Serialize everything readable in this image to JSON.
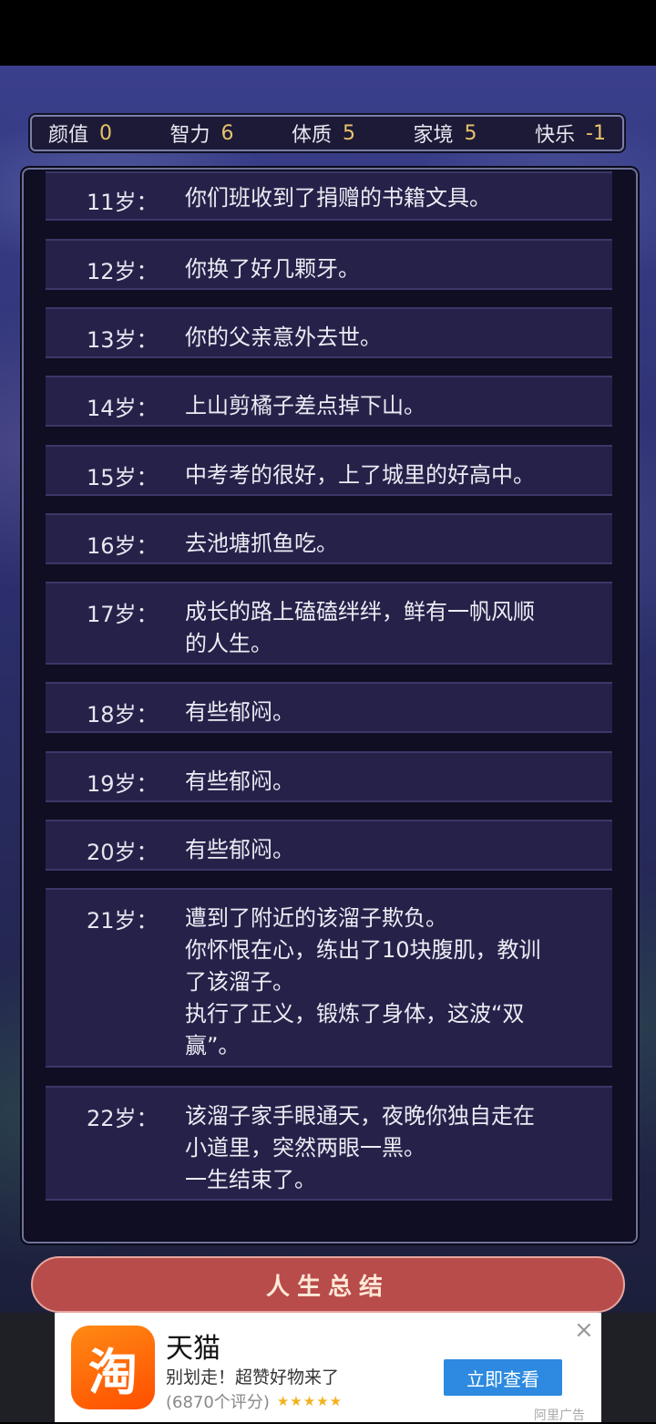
{
  "stats": [
    {
      "label": "颜值",
      "value": "0"
    },
    {
      "label": "智力",
      "value": "6"
    },
    {
      "label": "体质",
      "value": "5"
    },
    {
      "label": "家境",
      "value": "5"
    },
    {
      "label": "快乐",
      "value": "-1"
    }
  ],
  "events": [
    {
      "age": "11岁：",
      "text": "你们班收到了捐赠的书籍文具。"
    },
    {
      "age": "12岁：",
      "text": "你换了好几颗牙。"
    },
    {
      "age": "13岁：",
      "text": "你的父亲意外去世。"
    },
    {
      "age": "14岁：",
      "text": "上山剪橘子差点掉下山。"
    },
    {
      "age": "15岁：",
      "text": "中考考的很好，上了城里的好高中。"
    },
    {
      "age": "16岁：",
      "text": "去池塘抓鱼吃。"
    },
    {
      "age": "17岁：",
      "text": "成长的路上磕磕绊绊，鲜有一帆风顺\n的人生。"
    },
    {
      "age": "18岁：",
      "text": "有些郁闷。"
    },
    {
      "age": "19岁：",
      "text": "有些郁闷。"
    },
    {
      "age": "20岁：",
      "text": "有些郁闷。"
    },
    {
      "age": "21岁：",
      "text": "遭到了附近的该溜子欺负。\n你怀恨在心，练出了10块腹肌，教训\n了该溜子。\n执行了正义，锻炼了身体，这波“双\n赢”。"
    },
    {
      "age": "22岁：",
      "text": "该溜子家手眼通天，夜晚你独自走在\n小道里，突然两眼一黑。\n一生结束了。"
    }
  ],
  "summary_button": "人生总结",
  "ad": {
    "logo_char": "淘",
    "title": "天猫",
    "subtitle": "别划走！超赞好物来了",
    "rating": "(6870个评分)",
    "stars": "★★★★★",
    "button": "立即查看",
    "close": "×",
    "source": "阿里广告"
  }
}
